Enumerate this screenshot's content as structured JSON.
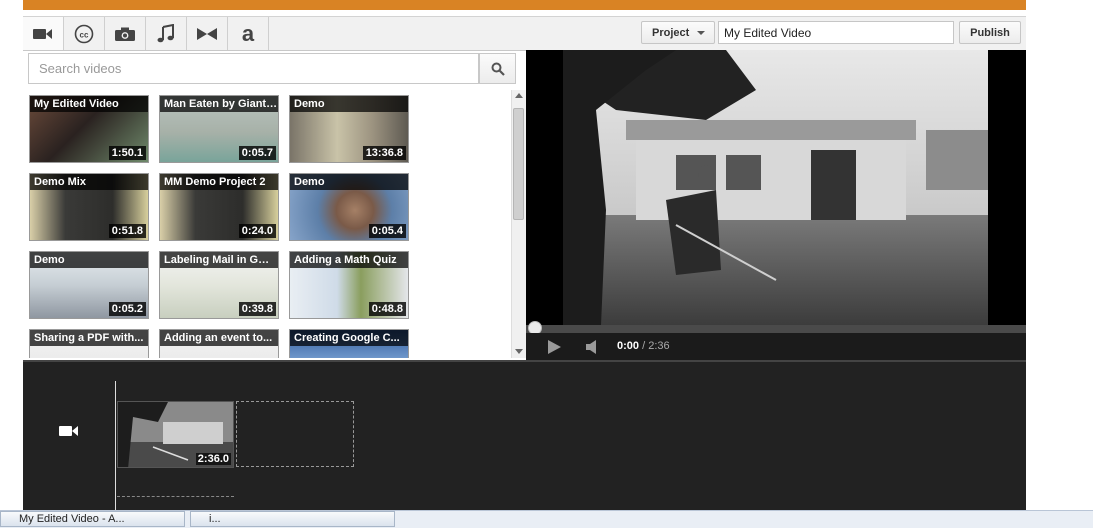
{
  "tabs": [
    {
      "icon": "video-camera-icon",
      "active": true
    },
    {
      "icon": "closed-captions-icon"
    },
    {
      "icon": "camera-icon"
    },
    {
      "icon": "music-note-icon"
    },
    {
      "icon": "transitions-icon"
    },
    {
      "icon": "text-icon",
      "glyph": "a"
    }
  ],
  "header": {
    "project_label": "Project",
    "video_title": "My Edited Video",
    "publish_label": "Publish"
  },
  "search": {
    "placeholder": "Search videos"
  },
  "videos": [
    {
      "title": "My Edited Video",
      "duration": "1:50.1"
    },
    {
      "title": "Man Eaten by Giant Snake",
      "duration": "0:05.7"
    },
    {
      "title": "Demo",
      "duration": "13:36.8"
    },
    {
      "title": "Demo Mix",
      "duration": "0:51.8"
    },
    {
      "title": "MM Demo Project 2",
      "duration": "0:24.0"
    },
    {
      "title": "Demo",
      "duration": "0:05.4"
    },
    {
      "title": "Demo",
      "duration": "0:05.2"
    },
    {
      "title": "Labeling Mail in Gmail",
      "duration": "0:39.8"
    },
    {
      "title": "Adding a Math Quiz",
      "duration": "0:48.8"
    },
    {
      "title": "Sharing a PDF with...",
      "duration": ""
    },
    {
      "title": "Adding an event to...",
      "duration": ""
    },
    {
      "title": "Creating Google C...",
      "duration": ""
    }
  ],
  "player": {
    "current_time": "0:00",
    "total_time": "/ 2:36",
    "progress": 0
  },
  "timeline": {
    "clip_duration": "2:36.0"
  },
  "taskbar": {
    "items": [
      "My Edited Video - A...",
      "i..."
    ]
  },
  "colors": {
    "accent": "#d98324",
    "timeline_bg": "#222222",
    "player_bg": "#000000"
  }
}
